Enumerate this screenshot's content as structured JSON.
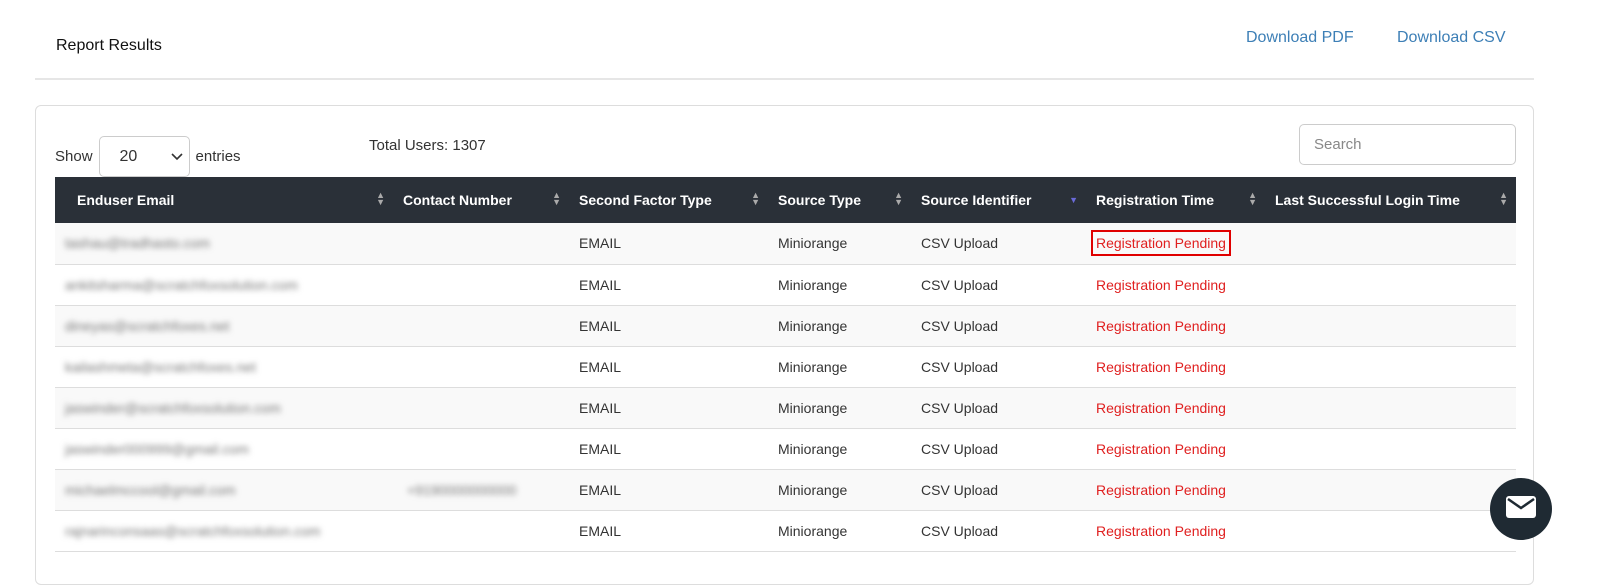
{
  "header": {
    "title": "Report Results",
    "download_pdf": "Download PDF",
    "download_csv": "Download CSV"
  },
  "controls": {
    "show_label": "Show",
    "entries_value": "20",
    "entries_label": "entries",
    "total_users": "Total Users: 1307",
    "search_placeholder": "Search"
  },
  "columns": [
    "Enduser Email",
    "Contact Number",
    "Second Factor Type",
    "Source Type",
    "Source Identifier",
    "Registration Time",
    "Last Successful Login Time"
  ],
  "sorted_column": "Source Identifier",
  "rows": [
    {
      "email": "tashau@tradhasto.com",
      "contact": "",
      "factor": "EMAIL",
      "source_type": "Miniorange",
      "source_id": "CSV Upload",
      "reg_time": "Registration Pending",
      "last_login": ""
    },
    {
      "email": "ankitsharma@scratchfoxsolution.com",
      "contact": "",
      "factor": "EMAIL",
      "source_type": "Miniorange",
      "source_id": "CSV Upload",
      "reg_time": "Registration Pending",
      "last_login": ""
    },
    {
      "email": "dineyas@scratchfoxes.net",
      "contact": "",
      "factor": "EMAIL",
      "source_type": "Miniorange",
      "source_id": "CSV Upload",
      "reg_time": "Registration Pending",
      "last_login": ""
    },
    {
      "email": "kailashmeta@scratchfoxes.net",
      "contact": "",
      "factor": "EMAIL",
      "source_type": "Miniorange",
      "source_id": "CSV Upload",
      "reg_time": "Registration Pending",
      "last_login": ""
    },
    {
      "email": "jaswinder@scratchfoxsolution.com",
      "contact": "",
      "factor": "EMAIL",
      "source_type": "Miniorange",
      "source_id": "CSV Upload",
      "reg_time": "Registration Pending",
      "last_login": ""
    },
    {
      "email": "jaswinder000999@gmail.com",
      "contact": "",
      "factor": "EMAIL",
      "source_type": "Miniorange",
      "source_id": "CSV Upload",
      "reg_time": "Registration Pending",
      "last_login": ""
    },
    {
      "email": "michaelmccool@gmail.com",
      "contact": "+9190000000000",
      "factor": "EMAIL",
      "source_type": "Miniorange",
      "source_id": "CSV Upload",
      "reg_time": "Registration Pending",
      "last_login": ""
    },
    {
      "email": "rajnarinconsaas@scratchfoxsolution.com",
      "contact": "",
      "factor": "EMAIL",
      "source_type": "Miniorange",
      "source_id": "CSV Upload",
      "reg_time": "Registration Pending",
      "last_login": ""
    }
  ],
  "colors": {
    "link": "#3d7fb6",
    "header_bg": "#2a3038",
    "pending": "#e02020",
    "highlight_box": "#e00000"
  }
}
